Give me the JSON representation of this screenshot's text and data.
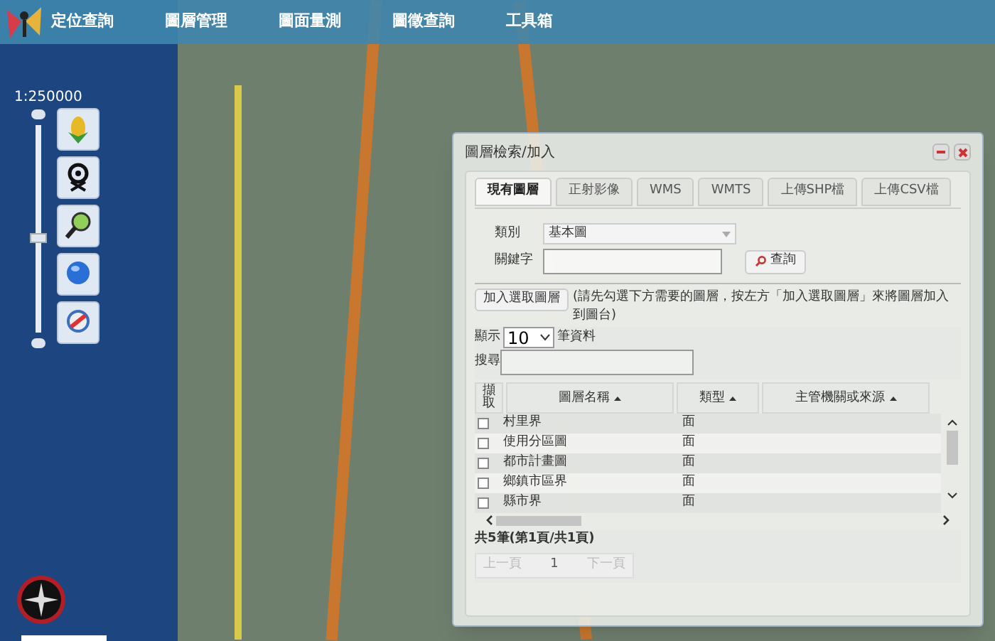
{
  "menu": [
    {
      "label": "定位查詢"
    },
    {
      "label": "圖層管理"
    },
    {
      "label": "圖面量測"
    },
    {
      "label": "圖徵查詢"
    },
    {
      "label": "工具箱"
    }
  ],
  "map": {
    "scale": "1:250000",
    "zoom": {
      "level": 0.43
    },
    "tools": [
      {
        "kind": "layers"
      },
      {
        "kind": "locate"
      },
      {
        "kind": "zoom"
      },
      {
        "kind": "globe"
      },
      {
        "kind": "clear"
      }
    ]
  },
  "dialog": {
    "title": "圖層檢索/加入",
    "tabs": [
      {
        "label": "現有圖層",
        "selected": true
      },
      {
        "label": "正射影像",
        "selected": false
      },
      {
        "label": "WMS",
        "selected": false
      },
      {
        "label": "WMTS",
        "selected": false
      },
      {
        "label": "上傳SHP檔",
        "selected": false
      },
      {
        "label": "上傳CSV檔",
        "selected": false
      }
    ],
    "category_label": "類別",
    "category_value": "基本圖",
    "keyword_label": "關鍵字",
    "query_button": "查詢",
    "add_button": "加入選取圖層",
    "add_hint": "(請先勾選下方需要的圖層，按左方「加入選取圖層」來將圖層加入到圖台)",
    "show_label": "顯示",
    "page_size": "10",
    "show_suffix": "筆資料",
    "search_label": "搜尋",
    "columns": [
      {
        "label": "擷取",
        "sortable": false
      },
      {
        "label": "圖層名稱",
        "sortable": true
      },
      {
        "label": "類型",
        "sortable": true
      },
      {
        "label": "主管機關或來源",
        "sortable": true
      }
    ],
    "rows": [
      {
        "name": "村里界",
        "type": "面",
        "checked": false
      },
      {
        "name": "使用分區圖",
        "type": "面",
        "checked": false
      },
      {
        "name": "都市計畫圖",
        "type": "面",
        "checked": false
      },
      {
        "name": "鄉鎮市區界",
        "type": "面",
        "checked": false
      },
      {
        "name": "縣市界",
        "type": "面",
        "checked": false
      }
    ],
    "summary": "共5筆(第1頁/共1頁)",
    "pager": [
      {
        "label": "上一頁",
        "disabled": true
      },
      {
        "label": "1",
        "disabled": false
      },
      {
        "label": "下一頁",
        "disabled": true
      }
    ]
  }
}
